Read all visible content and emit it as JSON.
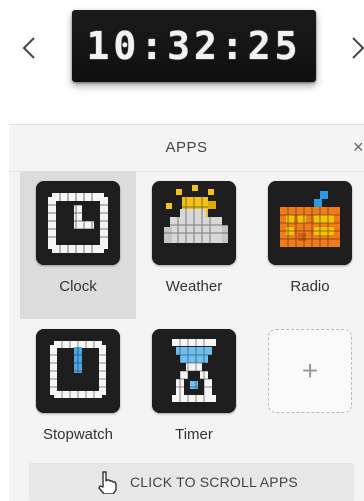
{
  "device": {
    "time": "10:32:25"
  },
  "panel": {
    "title": "APPS",
    "close_glyph": "×"
  },
  "apps": [
    {
      "label": "Clock",
      "icon": "clock-icon",
      "selected": true
    },
    {
      "label": "Weather",
      "icon": "weather-icon",
      "selected": false
    },
    {
      "label": "Radio",
      "icon": "radio-icon",
      "selected": false
    },
    {
      "label": "Stopwatch",
      "icon": "stopwatch-icon",
      "selected": false
    },
    {
      "label": "Timer",
      "icon": "hourglass-icon",
      "selected": false
    },
    {
      "label": "",
      "icon": "add-icon",
      "selected": false
    }
  ],
  "add_app": {
    "glyph": "+"
  },
  "scroll_button": {
    "label": "CLICK TO SCROLL APPS",
    "icon": "hand-pointer-icon"
  },
  "colors": {
    "weather_sun": "#f2c21b",
    "weather_cloud": "#d8d8d8",
    "radio_body": "#f07b1c",
    "radio_antenna": "#2a9be0",
    "stopwatch_accent": "#4aa8e8",
    "timer_sand": "#6cc0f2",
    "selected_tile": "#dcdcdc"
  }
}
